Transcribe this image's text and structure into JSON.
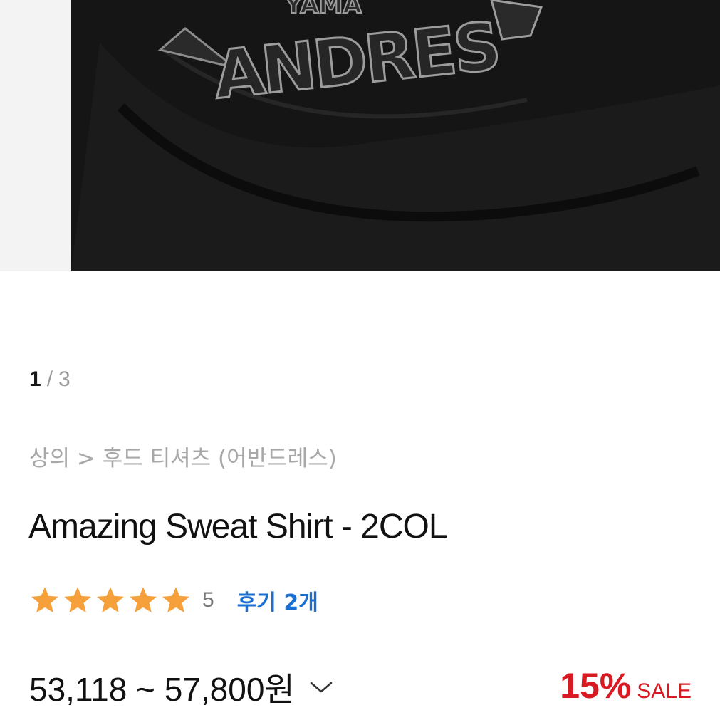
{
  "pager": {
    "current": "1",
    "separator": "/",
    "total": "3"
  },
  "breadcrumb": "상의 > 후드 티셔츠 (어반드레스)",
  "product": {
    "title": "Amazing Sweat Shirt - 2COL",
    "rating_stars": 5,
    "rating_score": "5",
    "reviews_label": "후기 2개",
    "price_range": "53,118 ~ 57,800원",
    "discount_percent": "15%",
    "sale_label": "SALE"
  },
  "hero_image": {
    "print_text_top": "YAMA",
    "print_text_main": "ANDRES"
  },
  "colors": {
    "accent_blue": "#1a6fd1",
    "sale_red": "#d81a23",
    "star_orange": "#f5a03a"
  }
}
